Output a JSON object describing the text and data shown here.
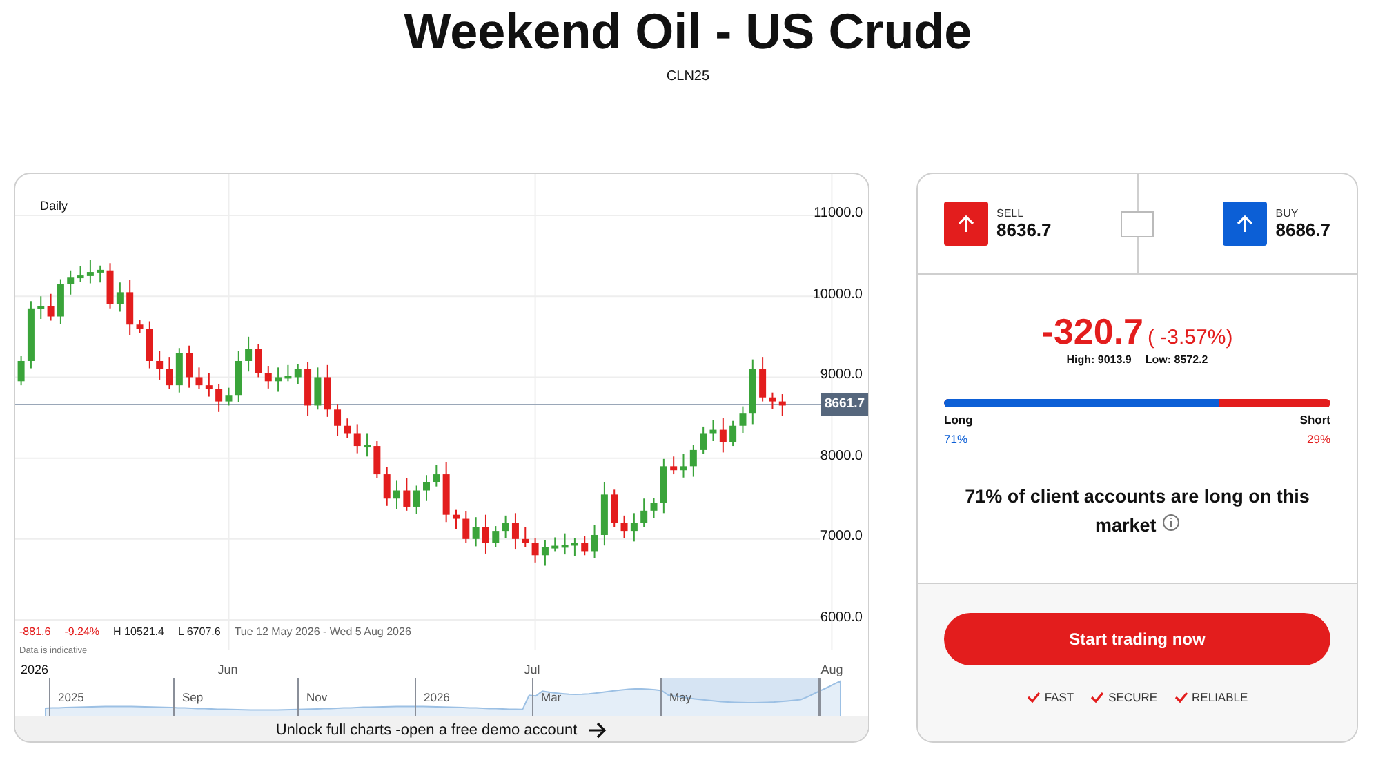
{
  "title": "Weekend Oil - US Crude",
  "subtitle": "CLN25",
  "chart": {
    "interval": "Daily",
    "chart_data": {
      "type": "candlestick",
      "categories": [
        null,
        null,
        null,
        null,
        null,
        null,
        null,
        null,
        null,
        null,
        null,
        null,
        null,
        null,
        null,
        null,
        null,
        null,
        null,
        null,
        null,
        "Jun",
        null,
        null,
        null,
        null,
        null,
        null,
        null,
        null,
        null,
        null,
        null,
        null,
        null,
        null,
        null,
        null,
        null,
        null,
        null,
        null,
        null,
        null,
        null,
        null,
        null,
        null,
        null,
        null,
        null,
        null,
        "Jul",
        null,
        null,
        null,
        null,
        null,
        null,
        null,
        null,
        null,
        null,
        null,
        null,
        null,
        null,
        null,
        null,
        null,
        null,
        null,
        null,
        null,
        null,
        null,
        null,
        null,
        null,
        null,
        null,
        null,
        "Aug"
      ],
      "ohlc": [
        [
          8950,
          9260,
          8900,
          9200
        ],
        [
          9200,
          9940,
          9110,
          9850
        ],
        [
          9850,
          10000,
          9720,
          9880
        ],
        [
          9880,
          10030,
          9700,
          9750
        ],
        [
          9750,
          10210,
          9660,
          10150
        ],
        [
          10150,
          10320,
          10020,
          10230
        ],
        [
          10230,
          10370,
          10180,
          10250
        ],
        [
          10250,
          10450,
          10160,
          10300
        ],
        [
          10300,
          10380,
          10170,
          10320
        ],
        [
          10320,
          10410,
          9850,
          9900
        ],
        [
          9900,
          10170,
          9810,
          10050
        ],
        [
          10050,
          10200,
          9520,
          9650
        ],
        [
          9650,
          9710,
          9550,
          9600
        ],
        [
          9600,
          9690,
          9110,
          9200
        ],
        [
          9200,
          9320,
          8970,
          9100
        ],
        [
          9100,
          9250,
          8850,
          8900
        ],
        [
          8900,
          9360,
          8810,
          9300
        ],
        [
          9300,
          9390,
          8870,
          9000
        ],
        [
          9000,
          9120,
          8850,
          8900
        ],
        [
          8900,
          9050,
          8760,
          8850
        ],
        [
          8850,
          8910,
          8570,
          8700
        ],
        [
          8700,
          8870,
          8650,
          8780
        ],
        [
          8780,
          9320,
          8690,
          9200
        ],
        [
          9200,
          9500,
          9070,
          9350
        ],
        [
          9350,
          9410,
          9000,
          9050
        ],
        [
          9050,
          9140,
          8860,
          8950
        ],
        [
          8950,
          9120,
          8820,
          9000
        ],
        [
          9000,
          9150,
          8950,
          9000
        ],
        [
          9000,
          9160,
          8910,
          9100
        ],
        [
          9100,
          9190,
          8520,
          8650
        ],
        [
          8650,
          9120,
          8600,
          9000
        ],
        [
          9000,
          9150,
          8510,
          8600
        ],
        [
          8600,
          8660,
          8270,
          8400
        ],
        [
          8400,
          8490,
          8250,
          8300
        ],
        [
          8300,
          8420,
          8060,
          8150
        ],
        [
          8150,
          8300,
          8020,
          8150
        ],
        [
          8150,
          8210,
          7750,
          7800
        ],
        [
          7800,
          7890,
          7410,
          7500
        ],
        [
          7500,
          7720,
          7370,
          7600
        ],
        [
          7600,
          7750,
          7350,
          7400
        ],
        [
          7400,
          7660,
          7310,
          7600
        ],
        [
          7600,
          7790,
          7470,
          7700
        ],
        [
          7700,
          7920,
          7650,
          7800
        ],
        [
          7800,
          7950,
          7210,
          7300
        ],
        [
          7300,
          7360,
          7120,
          7250
        ],
        [
          7250,
          7340,
          6950,
          7000
        ],
        [
          7000,
          7270,
          6910,
          7150
        ],
        [
          7150,
          7300,
          6820,
          6950
        ],
        [
          6950,
          7160,
          6900,
          7100
        ],
        [
          7100,
          7290,
          7010,
          7200
        ],
        [
          7200,
          7320,
          6870,
          7000
        ],
        [
          7000,
          7150,
          6900,
          6950
        ],
        [
          6950,
          7010,
          6710,
          6800
        ],
        [
          6800,
          6990,
          6670,
          6900
        ],
        [
          6900,
          7020,
          6850,
          6900
        ],
        [
          6900,
          7070,
          6810,
          6920
        ],
        [
          6920,
          7010,
          6790,
          6950
        ],
        [
          6950,
          7040,
          6800,
          6850
        ],
        [
          6850,
          7170,
          6760,
          7050
        ],
        [
          7050,
          7700,
          6920,
          7550
        ],
        [
          7550,
          7610,
          7150,
          7200
        ],
        [
          7200,
          7290,
          7010,
          7100
        ],
        [
          7100,
          7320,
          6970,
          7200
        ],
        [
          7200,
          7500,
          7150,
          7350
        ],
        [
          7350,
          7510,
          7260,
          7450
        ],
        [
          7450,
          7990,
          7320,
          7900
        ],
        [
          7900,
          8020,
          7800,
          7850
        ],
        [
          7850,
          8050,
          7760,
          7900
        ],
        [
          7900,
          8160,
          7770,
          8100
        ],
        [
          8100,
          8390,
          8050,
          8300
        ],
        [
          8300,
          8470,
          8210,
          8350
        ],
        [
          8350,
          8500,
          8070,
          8200
        ],
        [
          8200,
          8460,
          8150,
          8400
        ],
        [
          8400,
          8640,
          8310,
          8550
        ],
        [
          8550,
          9220,
          8420,
          9100
        ],
        [
          9100,
          9250,
          8700,
          8750
        ],
        [
          8750,
          8810,
          8610,
          8700
        ],
        [
          8700,
          8790,
          8520,
          8650
        ],
        null,
        null,
        null,
        null,
        null
      ],
      "ylim": [
        5625,
        11512
      ],
      "grid": true,
      "ref_lines": [
        {
          "value": 8661.7,
          "axis": "y",
          "label": "8661.7"
        }
      ],
      "yticks": [
        {
          "value": 11000,
          "label": "11000.0"
        },
        {
          "value": 10000,
          "label": "10000.0"
        },
        {
          "value": 9000,
          "label": "9000.0"
        },
        {
          "value": 8000,
          "label": "8000.0"
        },
        {
          "value": 7000,
          "label": "7000.0"
        },
        {
          "value": 6000,
          "label": "6000.0"
        }
      ]
    },
    "stats": {
      "change": "-881.6",
      "change_pct": "-9.24%",
      "high": "H 10521.4",
      "low": "L 6707.6",
      "range": "Tue 12 May 2026 - Wed 5 Aug 2026"
    },
    "note": "Data is indicative",
    "year_label": "2026",
    "navigator_labels": [
      "2025",
      "Sep",
      "Nov",
      "2026",
      "Mar",
      "May"
    ],
    "unlock": "Unlock full charts -open a free demo account"
  },
  "sell": {
    "label": "SELL",
    "price": "8636.7"
  },
  "buy": {
    "label": "BUY",
    "price": "8686.7"
  },
  "change": {
    "value": "-320.7",
    "pct": "( -3.57%)",
    "high": "High: 9013.9",
    "low": "Low: 8572.2"
  },
  "sentiment": {
    "level": 0.71,
    "long_label": "Long",
    "short_label": "Short",
    "long_pct": "71%",
    "short_pct": "29%",
    "message": "71% of client accounts are long on this market"
  },
  "cta": "Start trading now",
  "features": [
    "FAST",
    "SECURE",
    "RELIABLE"
  ]
}
